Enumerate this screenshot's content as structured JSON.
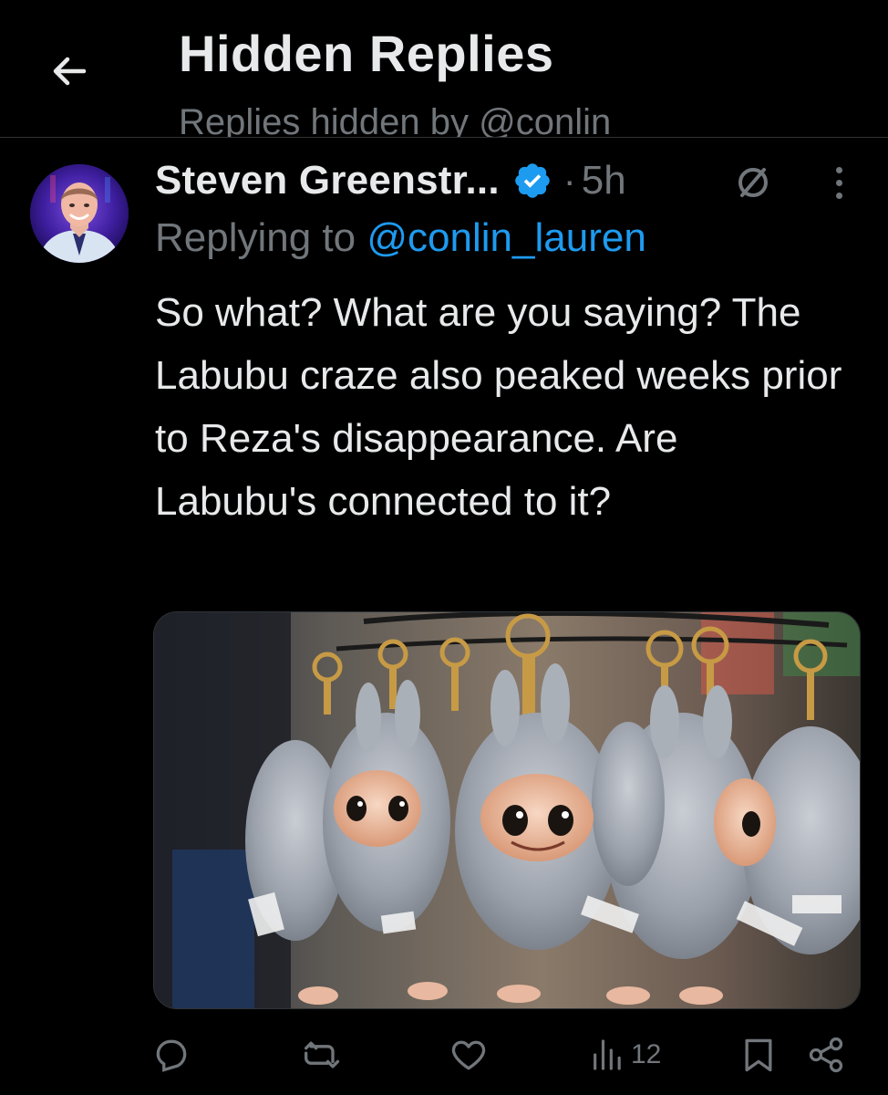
{
  "header": {
    "back_icon": "arrow-left-icon",
    "title": "Hidden Replies",
    "subtitle": "Replies hidden by @conlin"
  },
  "post": {
    "author_name": "Steven Greenstr...",
    "verified_icon": "verified-badge-icon",
    "separator": "·",
    "timestamp": "5h",
    "hidden_icon": "hidden-circle-slash-icon",
    "more_icon": "more-vertical-icon",
    "replying_prefix": "Replying to",
    "replying_handle": "@conlin_lauren",
    "text": "So what? What are you saying? The Labubu craze also peaked weeks prior to Reza's disappearance. Are Labubu's connected to it?",
    "media_description_icon": "photo-of-plush-keychains"
  },
  "actions": {
    "reply_icon": "reply-icon",
    "repost_icon": "repost-icon",
    "like_icon": "heart-icon",
    "views_icon": "views-bar-chart-icon",
    "views_count": "12",
    "bookmark_icon": "bookmark-icon",
    "share_icon": "share-icon"
  },
  "colors": {
    "background": "#000000",
    "text_primary": "#e7e9ea",
    "text_secondary": "#71767b",
    "accent": "#1d9bf0",
    "divider": "#2f3336"
  }
}
